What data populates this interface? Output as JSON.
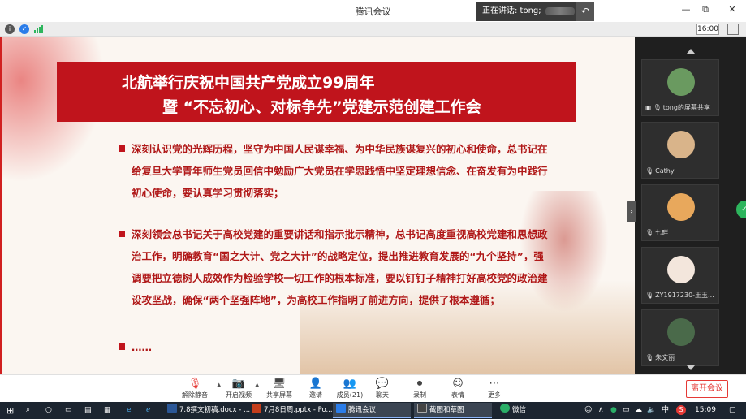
{
  "window": {
    "title": "腾讯会议",
    "speaking_label": "正在讲话: tong;",
    "controls": [
      "—",
      "▢",
      "⧉",
      "✕"
    ]
  },
  "infobar": {
    "meeting_time": "16:00"
  },
  "slide": {
    "title_line1": "北航举行庆祝中国共产党成立99周年",
    "title_line2": "暨 “不忘初心、对标争先”党建示范创建工作会",
    "paragraph1": "深刻认识党的光辉历程，坚守为中国人民谋幸福、为中华民族谋复兴的初心和使命，总书记在给复旦大学青年师生党员回信中勉励广大党员在学思践悟中坚定理想信念、在奋发有为中践行初心使命，要认真学习贯彻落实；",
    "paragraph2": "深刻领会总书记关于高校党建的重要讲话和指示批示精神，总书记高度重视高校党建和思想政治工作，明确教育“国之大计、党之大计”的战略定位，提出推进教育发展的“九个坚持”，强调要把立德树人成效作为检验学校一切工作的根本标准，要以钉钉子精神打好高校党的政治建设攻坚战，确保“两个坚强阵地”，为高校工作指明了前进方向，提供了根本遵循；",
    "paragraph3": "……"
  },
  "participants": [
    {
      "name": "tong的屏幕共享",
      "color": "#6a9a60"
    },
    {
      "name": "Cathy",
      "color": "#d9b48a"
    },
    {
      "name": "七畔",
      "color": "#e8a85c"
    },
    {
      "name": "ZY1917230-王玉...",
      "color": "#f3e6dc"
    },
    {
      "name": "朱文丽",
      "color": "#4a6a4a"
    }
  ],
  "toolbar": {
    "buttons": [
      {
        "label": "解除静音",
        "icon": "🎙"
      },
      {
        "label": "开启视频",
        "icon": "📷"
      },
      {
        "label": "共享屏幕",
        "icon": "🖥"
      },
      {
        "label": "邀请",
        "icon": "👤"
      },
      {
        "label": "成员(21)",
        "icon": "👥"
      },
      {
        "label": "聊天",
        "icon": "💬"
      },
      {
        "label": "录制",
        "icon": "⏺"
      },
      {
        "label": "表情",
        "icon": "☺"
      },
      {
        "label": "更多",
        "icon": "⋯"
      }
    ],
    "leave_label": "离开会议"
  },
  "taskbar": {
    "apps": [
      {
        "label": "7.8撰文初稿.docx - ...",
        "color": "#2b5797"
      },
      {
        "label": "7月8日周.pptx - Po...",
        "color": "#c43e1c"
      },
      {
        "label": "腾讯会议",
        "color": "#2b7de9"
      },
      {
        "label": "截图和草图",
        "color": "#444444"
      },
      {
        "label": "微信",
        "color": "#2aae67"
      }
    ],
    "ime": "中",
    "antivirus": "S",
    "clock": "15:09"
  },
  "colors": {
    "accent_red": "#c0141c",
    "panel_dark": "#1f1f1f",
    "leave_red": "#e53935"
  }
}
